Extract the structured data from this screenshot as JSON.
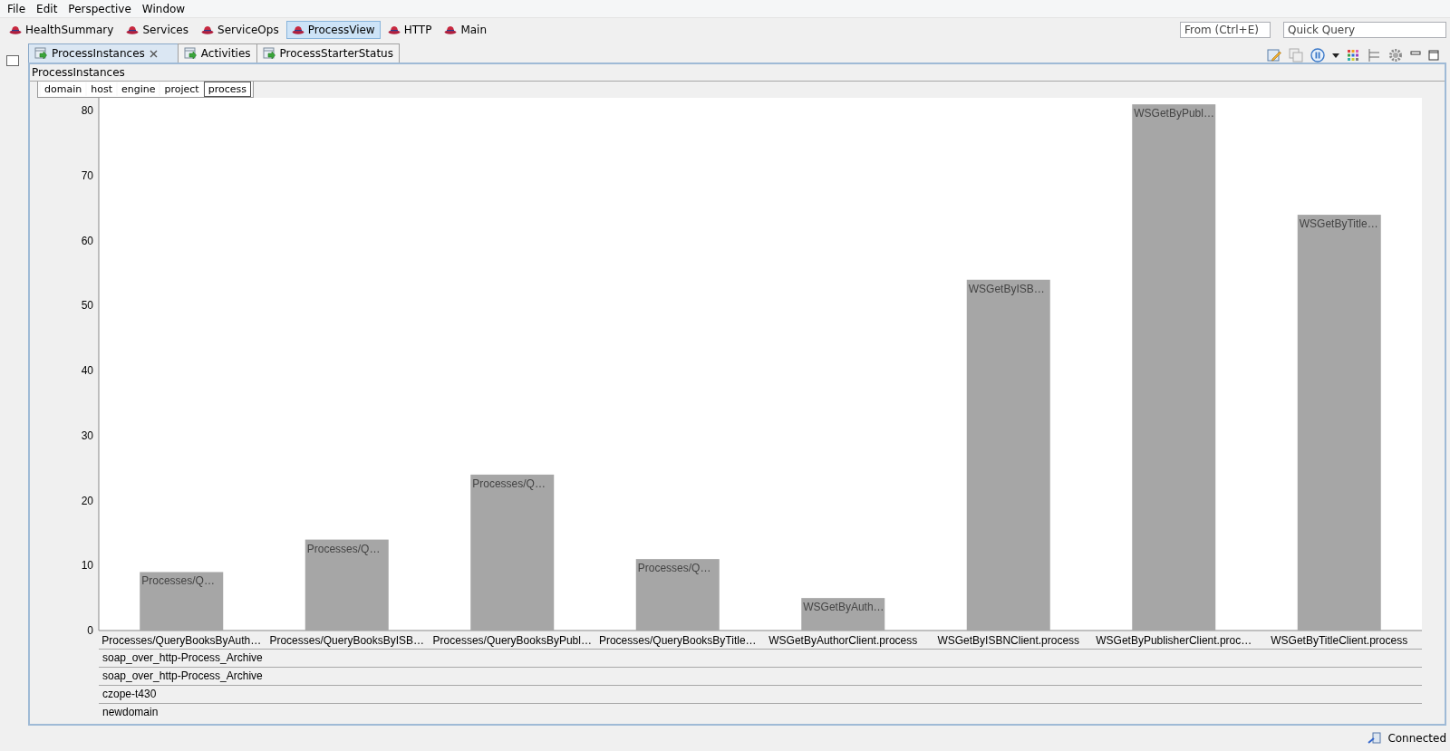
{
  "menu": [
    "File",
    "Edit",
    "Perspective",
    "Window"
  ],
  "perspectives": [
    {
      "label": "HealthSummary",
      "selected": false
    },
    {
      "label": "Services",
      "selected": false
    },
    {
      "label": "ServiceOps",
      "selected": false
    },
    {
      "label": "ProcessView",
      "selected": true
    },
    {
      "label": "HTTP",
      "selected": false
    },
    {
      "label": "Main",
      "selected": false
    }
  ],
  "quick_access": {
    "placeholder": "From (Ctrl+E)"
  },
  "quick_query": {
    "placeholder": "Quick Query"
  },
  "view_tabs": [
    {
      "label": "ProcessInstances",
      "selected": true
    },
    {
      "label": "Activities",
      "selected": false
    },
    {
      "label": "ProcessStarterStatus",
      "selected": false
    }
  ],
  "view_title": "ProcessInstances",
  "levels": [
    {
      "label": "domain",
      "selected": false
    },
    {
      "label": "host",
      "selected": false
    },
    {
      "label": "engine",
      "selected": false
    },
    {
      "label": "project",
      "selected": false
    },
    {
      "label": "process",
      "selected": true
    }
  ],
  "chart_data": {
    "type": "bar",
    "categories": [
      "Processes/QueryBooksByAuth…",
      "Processes/QueryBooksByISB…",
      "Processes/QueryBooksByPubl…",
      "Processes/QueryBooksByTitle…",
      "WSGetByAuthorClient.process",
      "WSGetByISBNClient.process",
      "WSGetByPublisherClient.proc…",
      "WSGetByTitleClient.process"
    ],
    "series": [
      {
        "color": "#a6a6a6",
        "values": [
          9,
          14,
          24,
          11,
          5,
          54,
          81,
          64
        ]
      }
    ],
    "ylim": [
      0,
      82
    ],
    "yticks": [
      0,
      10,
      20,
      30,
      40,
      50,
      60,
      70,
      80
    ],
    "value_labels": [
      "Processes/Q…",
      "Processes/Q…",
      "Processes/Q…",
      "Processes/Q…",
      "WSGetByAuth…",
      "WSGetByISB…",
      "WSGetByPubl…",
      "WSGetByTitle…"
    ]
  },
  "group_rows": [
    "soap_over_http-Process_Archive",
    "soap_over_http-Process_Archive",
    "czope-t430",
    "newdomain"
  ],
  "status": "Connected"
}
